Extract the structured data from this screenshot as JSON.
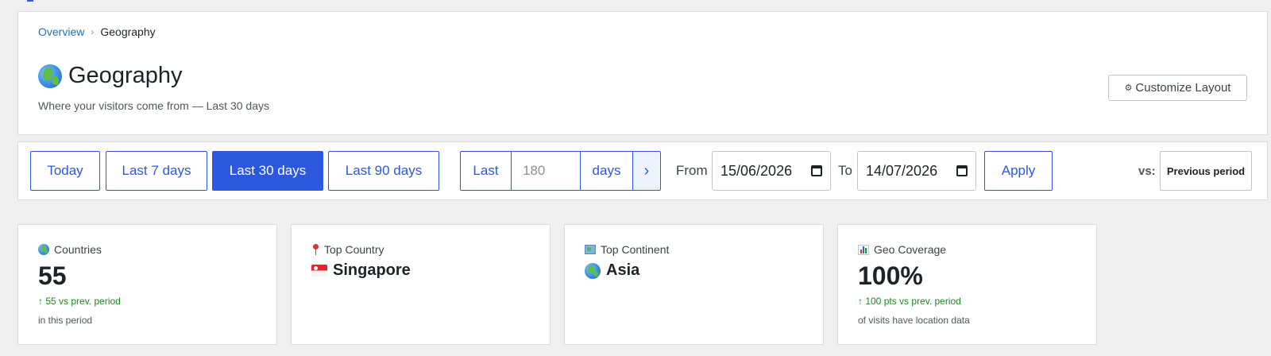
{
  "breadcrumb": {
    "parent": "Overview",
    "separator": "›",
    "current": "Geography"
  },
  "header": {
    "title": "Geography",
    "title_icon": "globe-icon",
    "subtitle": "Where your visitors come from — Last 30 days",
    "customize_label": "Customize Layout",
    "customize_icon": "⚙"
  },
  "filters": {
    "presets": [
      "Today",
      "Last 7 days",
      "Last 30 days",
      "Last 90 days"
    ],
    "active_preset": "Last 30 days",
    "custom_prefix": "Last",
    "custom_placeholder": "180",
    "custom_suffix": "days",
    "go_icon": "chevron-right-icon",
    "from_label": "From",
    "from_value": "15/06/2026",
    "to_label": "To",
    "to_value": "14/07/2026",
    "apply_label": "Apply",
    "compare_label": "vs:",
    "compare_value": "Previous period"
  },
  "stats": {
    "countries": {
      "label": "Countries",
      "icon": "globe-icon",
      "value": "55",
      "delta": "↑ 55 vs prev. period",
      "note": "in this period"
    },
    "top_country": {
      "label": "Top Country",
      "icon": "pin-icon",
      "value": "Singapore",
      "flag": "singapore-flag-icon"
    },
    "top_continent": {
      "label": "Top Continent",
      "icon": "map-icon",
      "value": "Asia",
      "value_icon": "globe-icon"
    },
    "geo_coverage": {
      "label": "Geo Coverage",
      "icon": "bar-chart-icon",
      "value": "100%",
      "delta": "↑ 100 pts vs prev. period",
      "note": "of visits have location data"
    }
  },
  "colors": {
    "accent": "#2c58de",
    "positive": "#1a8a1a",
    "link": "#2271b1"
  }
}
